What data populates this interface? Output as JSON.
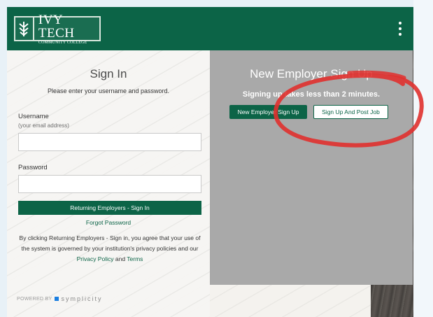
{
  "header": {
    "logo_line1": "IVY TECH",
    "logo_line2": "COMMUNITY COLLEGE",
    "menu_icon": "kebab-menu-icon",
    "color": "#0c6447"
  },
  "signin": {
    "title": "Sign In",
    "subtitle": "Please enter your username and password.",
    "username_label": "Username",
    "username_hint": "(your email address)",
    "username_value": "",
    "password_label": "Password",
    "password_value": "",
    "signin_button": "Returning Employers - Sign In",
    "forgot_link": "Forgot Password",
    "terms_text_1": "By clicking Returning Employers - Sign in, you agree that your use of the system is governed by your institution's privacy policies and our",
    "privacy_link": "Privacy Policy",
    "terms_and": "and",
    "terms_link": "Terms"
  },
  "new_employer": {
    "title": "New Employer Sign Up",
    "subtitle": "Signing up takes less than 2 minutes.",
    "signup_button": "New Employer Sign Up",
    "post_job_button": "Sign Up And Post Job"
  },
  "footer": {
    "powered_by": "POWERED BY",
    "brand": "symplicity",
    "brand_color": "#1a7ee0"
  },
  "annotation": {
    "color": "#e0302e"
  }
}
